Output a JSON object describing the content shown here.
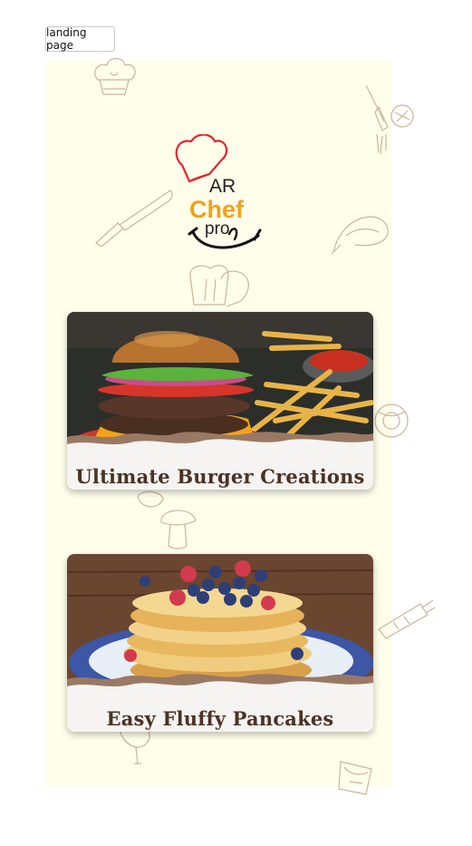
{
  "tab": {
    "label": "landing page"
  },
  "logo": {
    "line1": "AR",
    "line2": "Chef",
    "line3": "pro"
  },
  "colors": {
    "canvas": "#fffeeb",
    "logo_red": "#e0262d",
    "logo_orange": "#f0a21a",
    "title_brown": "#4a3224"
  },
  "cards": [
    {
      "title": "Ultimate Burger Creations",
      "image": "burger-and-fries-photo"
    },
    {
      "title": "Easy Fluffy Pancakes",
      "image": "berry-pancake-stack-photo"
    }
  ]
}
